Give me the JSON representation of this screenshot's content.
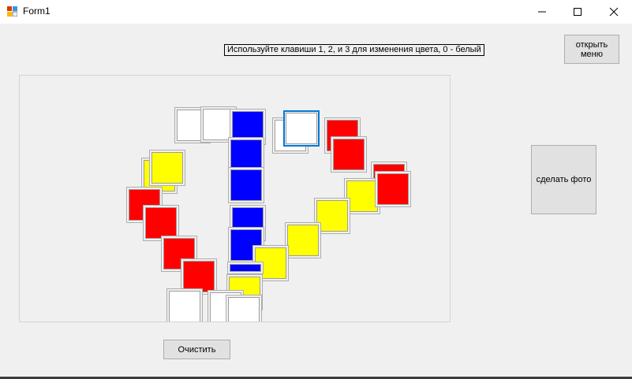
{
  "window": {
    "title": "Form1",
    "controls": {
      "minimize_icon": "minimize-icon",
      "maximize_icon": "maximize-icon",
      "close_icon": "close-icon"
    }
  },
  "hint": "Используйте клавиши 1, 2, и 3 для изменения цвета, 0 - белый",
  "buttons": {
    "open_menu": "открыть\nменю",
    "take_photo": "сделать фото",
    "clear": "Очистить"
  },
  "palette": {
    "white": "#ffffff",
    "red": "#ff0000",
    "yellow": "#ffff00",
    "blue": "#0000ff",
    "accent": "#0078d7"
  },
  "tiles": [
    {
      "color": "white"
    },
    {
      "color": "white"
    },
    {
      "color": "blue"
    },
    {
      "color": "white"
    },
    {
      "color": "yellow"
    },
    {
      "color": "yellow"
    },
    {
      "color": "blue"
    },
    {
      "color": "blue"
    },
    {
      "color": "red"
    },
    {
      "color": "red"
    },
    {
      "color": "blue"
    },
    {
      "color": "red"
    },
    {
      "color": "blue"
    },
    {
      "color": "red"
    },
    {
      "color": "red"
    },
    {
      "color": "red"
    },
    {
      "color": "yellow"
    },
    {
      "color": "yellow"
    },
    {
      "color": "yellow"
    },
    {
      "color": "yellow"
    },
    {
      "color": "red"
    },
    {
      "color": "blue"
    },
    {
      "color": "red"
    },
    {
      "color": "yellow"
    },
    {
      "color": "white"
    },
    {
      "color": "white"
    },
    {
      "color": "white"
    },
    {
      "color": "white",
      "active": true
    }
  ]
}
